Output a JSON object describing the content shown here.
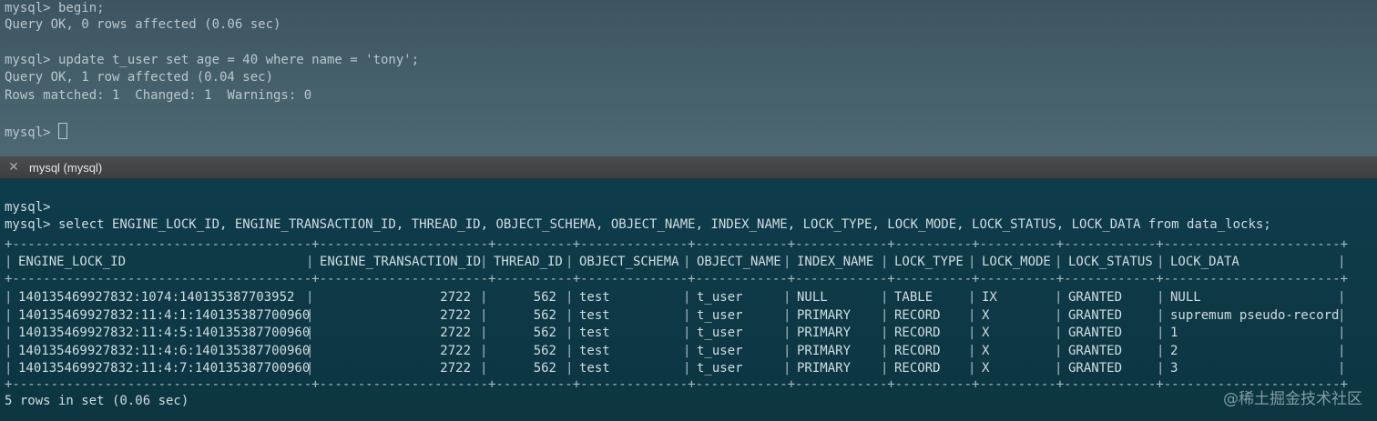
{
  "top_terminal": {
    "lines": [
      "mysql> begin;",
      "Query OK, 0 rows affected (0.06 sec)",
      "",
      "mysql> update t_user set age = 40 where name = 'tony';",
      "Query OK, 1 row affected (0.04 sec)",
      "Rows matched: 1  Changed: 1  Warnings: 0",
      ""
    ],
    "prompt": "mysql> "
  },
  "tab": {
    "title": "mysql (mysql)",
    "close_icon": "close-icon"
  },
  "bottom_terminal": {
    "prompt_line": "mysql>",
    "query": "mysql> select ENGINE_LOCK_ID, ENGINE_TRANSACTION_ID, THREAD_ID, OBJECT_SCHEMA, OBJECT_NAME, INDEX_NAME, LOCK_TYPE, LOCK_MODE, LOCK_STATUS, LOCK_DATA from data_locks;",
    "result_table": {
      "columns": [
        "ENGINE_LOCK_ID",
        "ENGINE_TRANSACTION_ID",
        "THREAD_ID",
        "OBJECT_SCHEMA",
        "OBJECT_NAME",
        "INDEX_NAME",
        "LOCK_TYPE",
        "LOCK_MODE",
        "LOCK_STATUS",
        "LOCK_DATA"
      ],
      "rows": [
        [
          "140135469927832:1074:140135387703952",
          "2722",
          "562",
          "test",
          "t_user",
          "NULL",
          "TABLE",
          "IX",
          "GRANTED",
          "NULL"
        ],
        [
          "140135469927832:11:4:1:140135387700960",
          "2722",
          "562",
          "test",
          "t_user",
          "PRIMARY",
          "RECORD",
          "X",
          "GRANTED",
          "supremum pseudo-record"
        ],
        [
          "140135469927832:11:4:5:140135387700960",
          "2722",
          "562",
          "test",
          "t_user",
          "PRIMARY",
          "RECORD",
          "X",
          "GRANTED",
          "1"
        ],
        [
          "140135469927832:11:4:6:140135387700960",
          "2722",
          "562",
          "test",
          "t_user",
          "PRIMARY",
          "RECORD",
          "X",
          "GRANTED",
          "2"
        ],
        [
          "140135469927832:11:4:7:140135387700960",
          "2722",
          "562",
          "test",
          "t_user",
          "PRIMARY",
          "RECORD",
          "X",
          "GRANTED",
          "3"
        ]
      ]
    },
    "summary": "5 rows in set (0.06 sec)"
  },
  "watermark": "@稀土掘金技术社区"
}
